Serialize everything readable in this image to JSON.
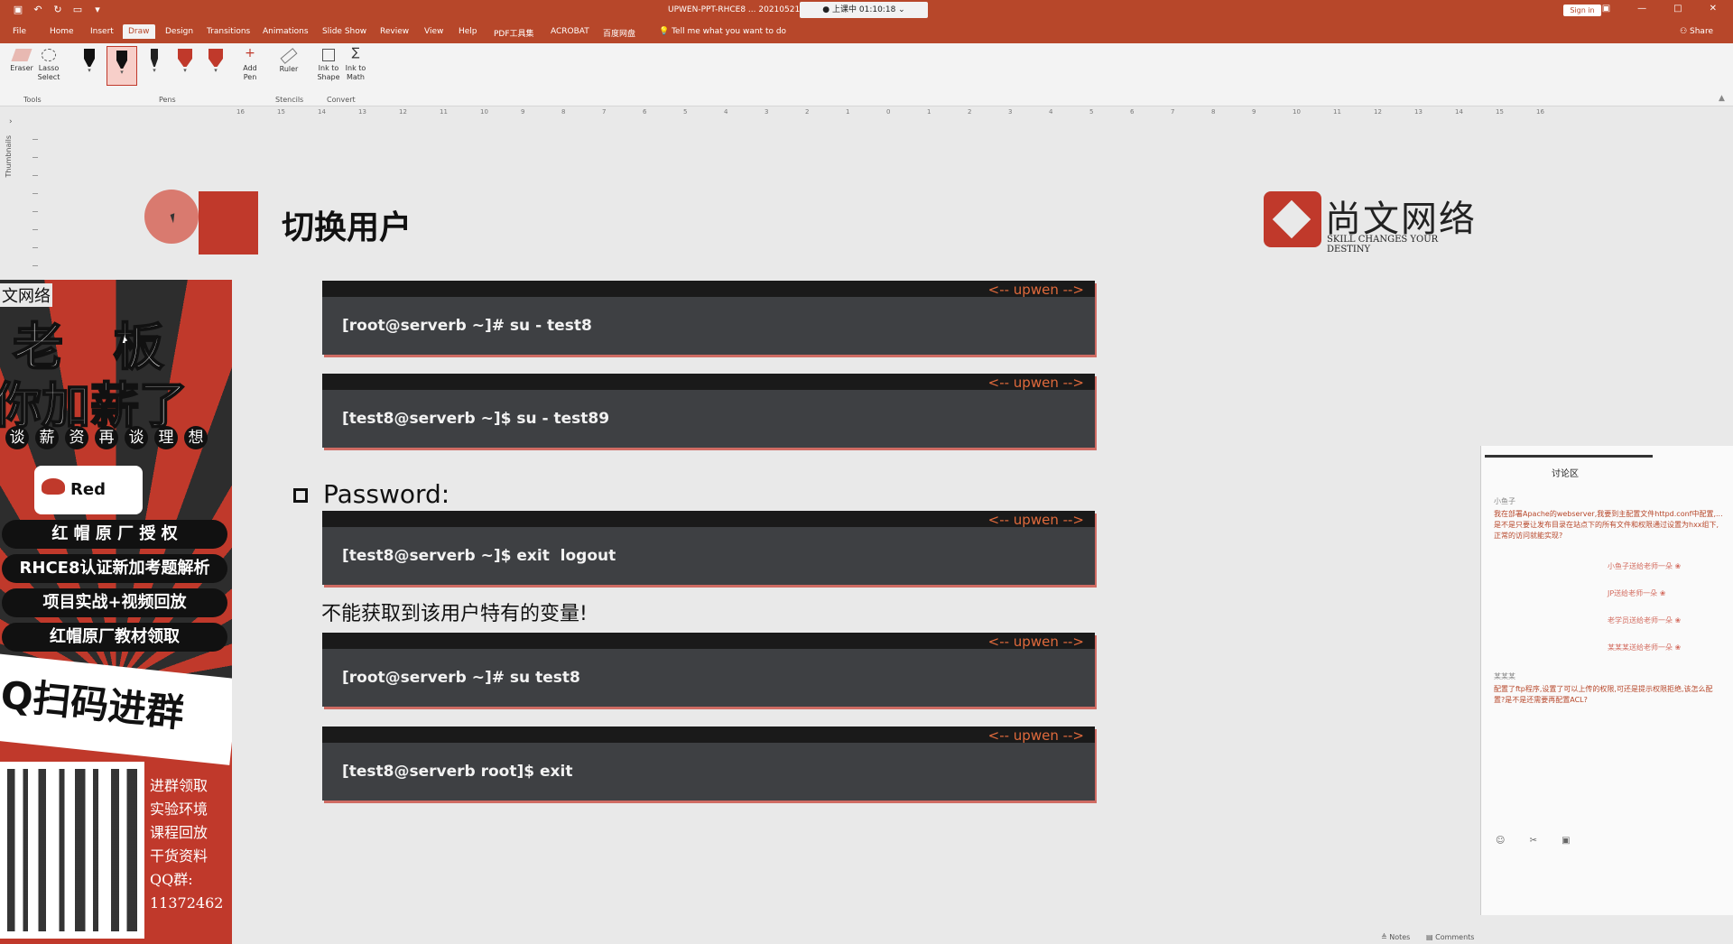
{
  "app": {
    "doc_title": "UPWEN-PPT-RHCE8 ... 20210521.pptx - PowerPoint Preview",
    "recording": "● 上课中 01:10:18 ⌄",
    "sign_in": "Sign in",
    "tabs": [
      "File",
      "Home",
      "Insert",
      "Draw",
      "Design",
      "Transitions",
      "Animations",
      "Slide Show",
      "Review",
      "View",
      "Help",
      "PDF工具集",
      "ACROBAT",
      "百度网盘"
    ],
    "active_tab": "Draw",
    "tell_me": "Tell me what you want to do",
    "share": "Share"
  },
  "ribbon": {
    "eraser": "Eraser",
    "lasso": "Lasso Select",
    "add_pen": "Add Pen",
    "ruler": "Ruler",
    "ink_shape": "Ink to Shape",
    "ink_math": "Ink to Math",
    "groups": {
      "tools": "Tools",
      "pens": "Pens",
      "stencils": "Stencils",
      "convert": "Convert"
    },
    "pen_colors": [
      "#111111",
      "#b7472a",
      "#111111",
      "#c0392b",
      "#c0392b",
      "#c0392b"
    ]
  },
  "sidebar": {
    "thumbnails": "Thumbnails"
  },
  "ruler": [
    "16",
    "15",
    "14",
    "13",
    "12",
    "11",
    "10",
    "9",
    "8",
    "7",
    "6",
    "5",
    "4",
    "3",
    "2",
    "1",
    "0",
    "1",
    "2",
    "3",
    "4",
    "5",
    "6",
    "7",
    "8",
    "9",
    "10",
    "11",
    "12",
    "13",
    "14",
    "15",
    "16"
  ],
  "slide": {
    "title": "切换用户",
    "logo_cn": "尚文网络",
    "logo_en": "SKILL CHANGES YOUR DESTINY",
    "code_tag": "<-- upwen -->",
    "blocks": [
      {
        "cmd": "[root@serverb ~]# su - test8"
      },
      {
        "cmd": "[test8@serverb ~]$ su - test89"
      },
      {
        "cmd": "[test8@serverb ~]$ exit  logout"
      },
      {
        "cmd": "[root@serverb ~]# su test8"
      },
      {
        "cmd": "[test8@serverb root]$ exit"
      }
    ],
    "password_label": "Password:",
    "warning": "不能获取到该用户特有的变量!"
  },
  "poster": {
    "brand": "文网络",
    "big1": "老 板",
    "big2": "你加薪了",
    "dots": [
      "谈",
      "薪",
      "资",
      "再",
      "谈",
      "理",
      "想"
    ],
    "redhat": "Red Hat",
    "pills": [
      "红 帽 原 厂 授 权",
      "RHCE8认证新加考题解析",
      "项目实战+视频回放",
      "红帽原厂教材领取"
    ],
    "scan": "Q扫码进群",
    "side": [
      "进群领取",
      "实验环境",
      "课程回放",
      "干货资料",
      "QQ群:",
      "11372462"
    ]
  },
  "chat": {
    "title": "讨论区",
    "user1": "小鱼子",
    "msg1": "我在部署Apache的webserver,我要到主配置文件httpd.conf中配置,...是不是只要让发布目录在站点下的所有文件和权限通过设置为hxx组下,正常的访问就能实现?",
    "gifts": [
      "小鱼子送给老师一朵 ❀",
      "JP送给老师一朵 ❀",
      "老学员送给老师一朵 ❀",
      "某某某送给老师一朵 ❀"
    ],
    "user2": "某某某",
    "msg2": "配置了ftp程序,设置了可以上传的权限,可还是提示权限拒绝,该怎么配置?是不是还需要再配置ACL?",
    "tools": "☺ ✂ ▣"
  },
  "status": {
    "notes": "≜ Notes",
    "comments": "▤ Comments"
  }
}
